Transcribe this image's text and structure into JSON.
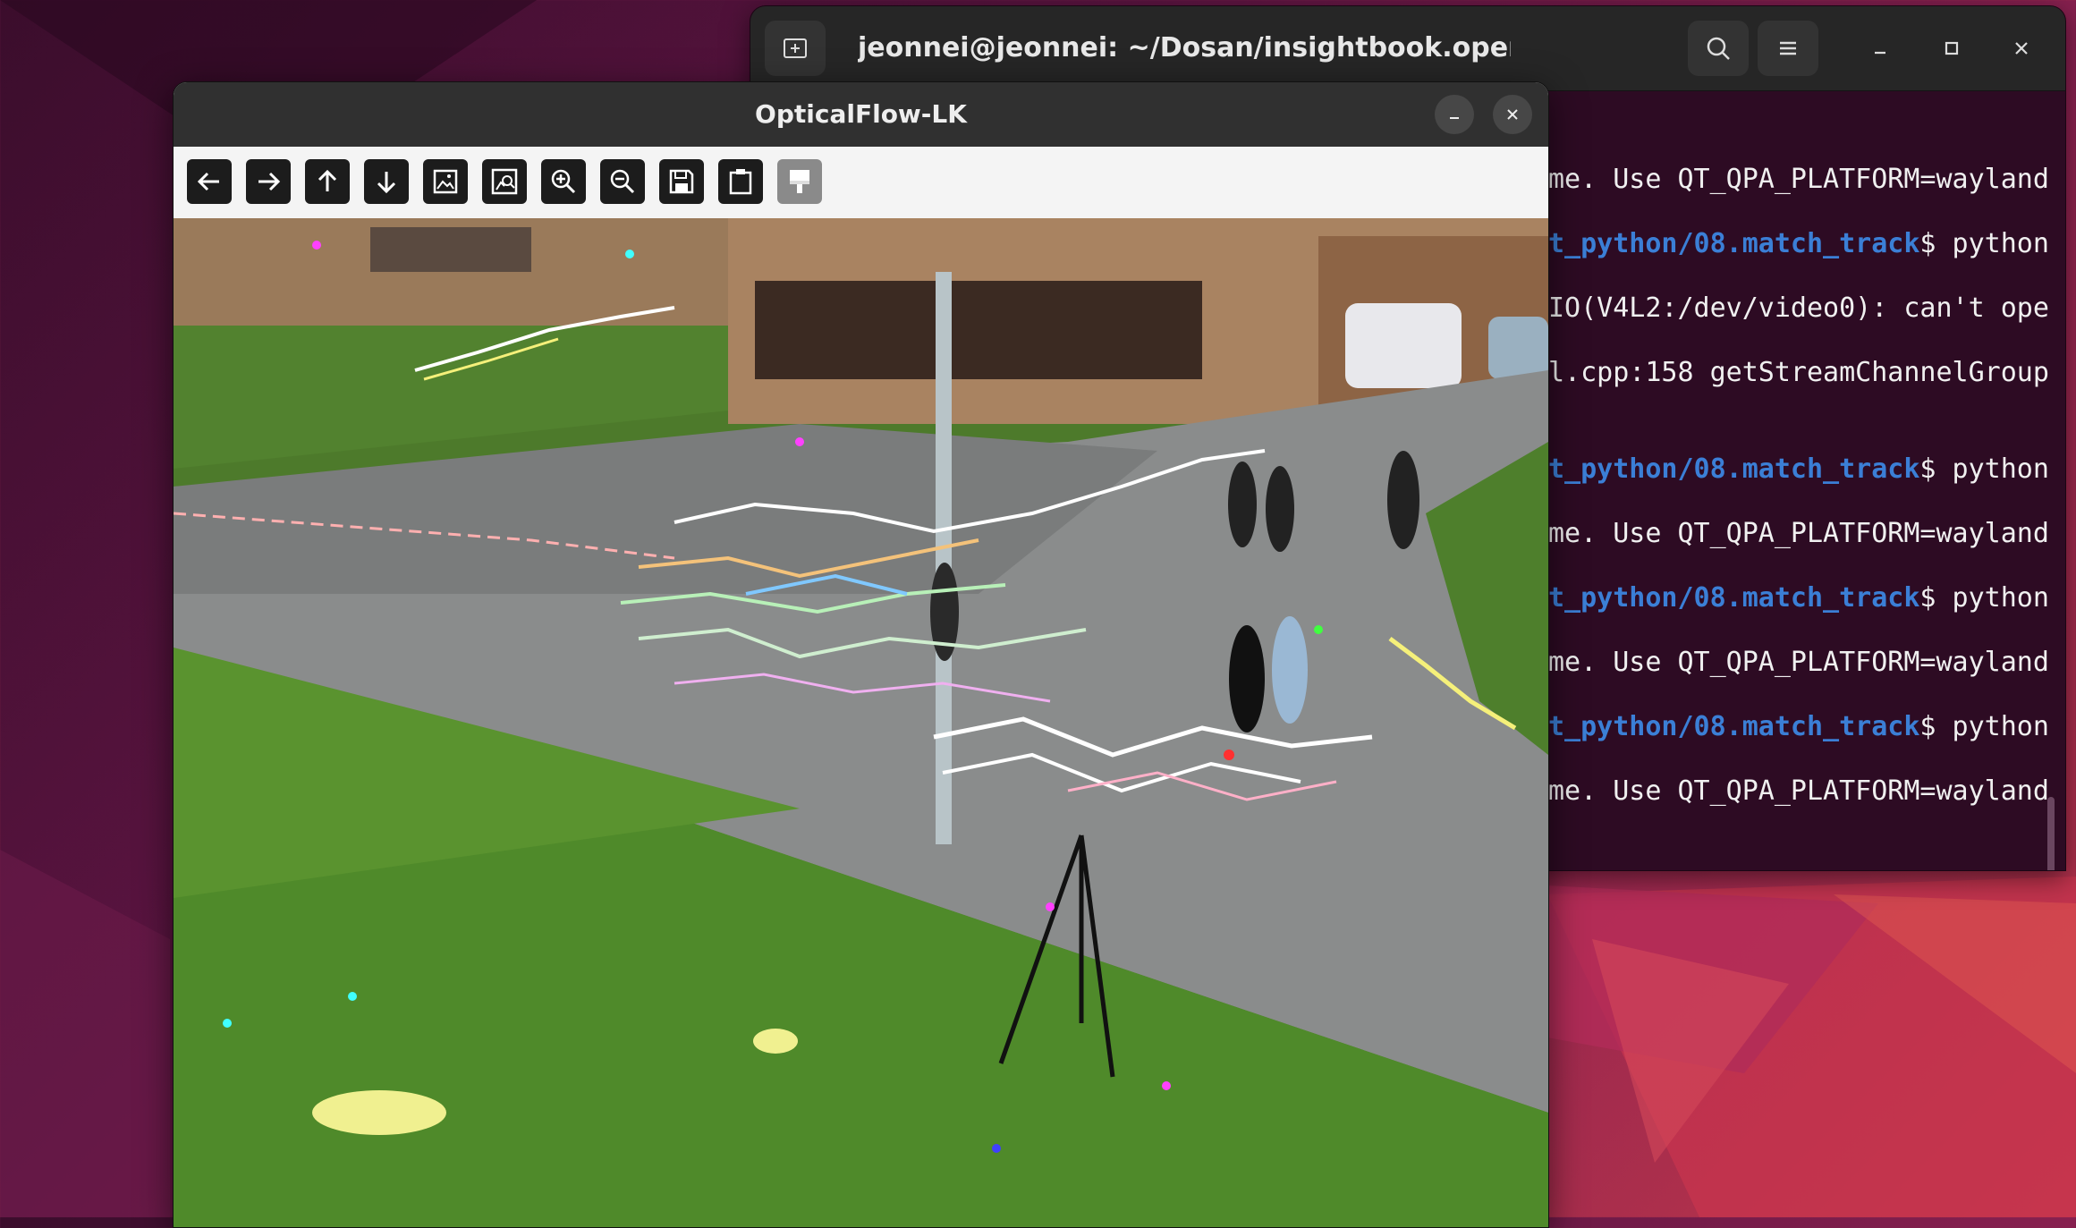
{
  "terminal": {
    "title": "jeonnei@jeonnei: ~/Dosan/insightbook.opencv_project_pyth...",
    "lines": [
      {
        "prefix": "",
        "path": "",
        "text": "me. Use QT_QPA_PLATFORM=wayland"
      },
      {
        "prefix": "",
        "path": "t_python/08.match_track",
        "text": "$ python"
      },
      {
        "prefix": "",
        "path": "",
        "text": "IO(V4L2:/dev/video0): can't ope"
      },
      {
        "prefix": "",
        "path": "",
        "text": "l.cpp:158 getStreamChannelGroup"
      },
      {
        "prefix": "",
        "path": "t_python/08.match_track",
        "text": "$ python"
      },
      {
        "prefix": "",
        "path": "",
        "text": "me. Use QT_QPA_PLATFORM=wayland"
      },
      {
        "prefix": "",
        "path": "t_python/08.match_track",
        "text": "$ python"
      },
      {
        "prefix": "",
        "path": "",
        "text": "me. Use QT_QPA_PLATFORM=wayland"
      },
      {
        "prefix": "",
        "path": "t_python/08.match_track",
        "text": "$ python"
      },
      {
        "prefix": "",
        "path": "",
        "text": "me. Use QT_QPA_PLATFORM=wayland"
      }
    ]
  },
  "cv_window": {
    "title": "OpticalFlow-LK",
    "toolbar": [
      {
        "name": "pan-left-button",
        "icon": "arrow-left-icon"
      },
      {
        "name": "pan-right-button",
        "icon": "arrow-right-icon"
      },
      {
        "name": "pan-up-button",
        "icon": "arrow-up-icon"
      },
      {
        "name": "pan-down-button",
        "icon": "arrow-down-icon"
      },
      {
        "name": "zoom-original-button",
        "icon": "image-icon"
      },
      {
        "name": "zoom-fit-button",
        "icon": "image-fit-icon"
      },
      {
        "name": "zoom-in-button",
        "icon": "zoom-in-icon"
      },
      {
        "name": "zoom-out-button",
        "icon": "zoom-out-icon"
      },
      {
        "name": "save-button",
        "icon": "save-icon"
      },
      {
        "name": "copy-clipboard-button",
        "icon": "clipboard-icon"
      },
      {
        "name": "properties-button",
        "icon": "paint-brush-icon"
      }
    ]
  },
  "colors": {
    "terminal_bg": "#2d0b23",
    "prompt_path": "#3b7fd6",
    "cv_header": "#303030"
  }
}
